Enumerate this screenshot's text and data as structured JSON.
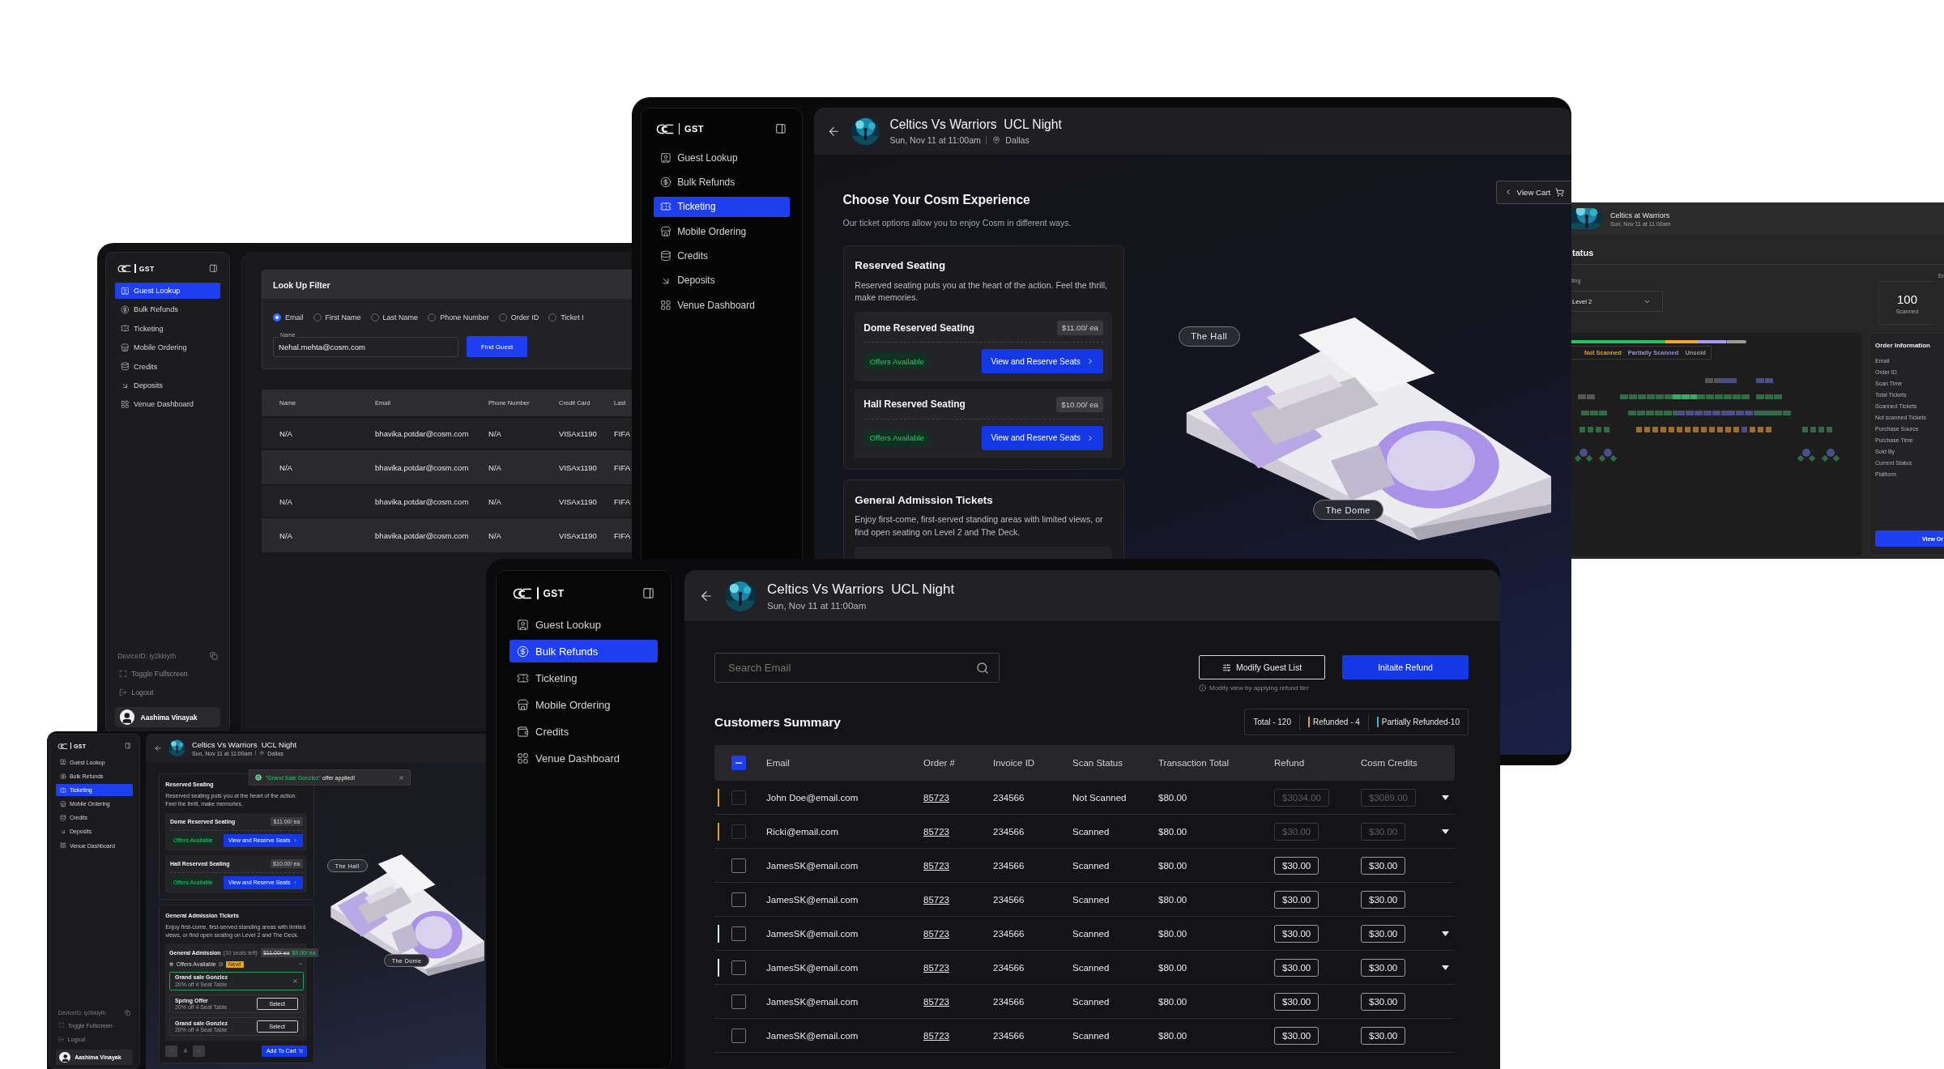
{
  "guest_lookup_screen": {
    "sidebar": {
      "brand": "GST",
      "items": [
        {
          "label": "Guest Lookup",
          "selected": true
        },
        {
          "label": "Bulk Refunds",
          "selected": false
        },
        {
          "label": "Ticketing",
          "selected": false
        },
        {
          "label": "Mobile Ordering",
          "selected": false
        },
        {
          "label": "Credits",
          "selected": false
        },
        {
          "label": "Deposits",
          "selected": false
        },
        {
          "label": "Venue Dashboard",
          "selected": false
        }
      ],
      "footer": {
        "device_id": "DeviceID: iy2kkiyth",
        "links": [
          "Toggle Fullscreen",
          "Logout"
        ],
        "user": "Aashima Vinayak"
      }
    },
    "filter": {
      "title": "Look Up Filter",
      "options": [
        {
          "label": "Email",
          "selected": true
        },
        {
          "label": "First Name",
          "selected": false
        },
        {
          "label": "Last Name",
          "selected": false
        },
        {
          "label": "Phone Number",
          "selected": false
        },
        {
          "label": "Order ID",
          "selected": false
        },
        {
          "label": "Ticket I",
          "selected": false
        }
      ],
      "field": {
        "label": "Name",
        "value": "Nehal.mehta@cosm.com"
      },
      "button": "Find Guest"
    },
    "table": {
      "columns": [
        "Name",
        "Email",
        "Phone Number",
        "Credit Card",
        "Last"
      ],
      "rows": [
        [
          "N/A",
          "bhavika.potdar@cosm.com",
          "N/A",
          "VISAx1190",
          "FIFA"
        ],
        [
          "N/A",
          "bhavika.potdar@cosm.com",
          "N/A",
          "VISAx1190",
          "FIFA"
        ],
        [
          "N/A",
          "bhavika.potdar@cosm.com",
          "N/A",
          "VISAx1190",
          "FIFA"
        ],
        [
          "N/A",
          "bhavika.potdar@cosm.com",
          "N/A",
          "VISAx1190",
          "FIFA"
        ]
      ]
    }
  },
  "ticketing_screen": {
    "sidebar": {
      "brand": "GST",
      "items": [
        {
          "label": "Guest Lookup",
          "selected": false
        },
        {
          "label": "Bulk Refunds",
          "selected": false
        },
        {
          "label": "Ticketing",
          "selected": true
        },
        {
          "label": "Mobile Ordering",
          "selected": false
        },
        {
          "label": "Credits",
          "selected": false
        },
        {
          "label": "Deposits",
          "selected": false
        },
        {
          "label": "Venue Dashboard",
          "selected": false
        }
      ]
    },
    "event": {
      "title": "Celtics Vs Warriors  UCL Night",
      "date": "Sun, Nov 11 at 11:00am",
      "location": "Dallas"
    },
    "heading": "Choose Your Cosm Experience",
    "subtitle": "Our ticket options allow you to enjoy Cosm in different ways.",
    "view_cart": "View Cart",
    "sections": [
      {
        "title": "Reserved Seating",
        "description": "Reserved seating puts you at the heart of the action. Feel the thrill, make memories.",
        "options": [
          {
            "name": "Dome Reserved Seating",
            "price": "$11.00/ ea",
            "offers": "Offers Available",
            "action": "View and Reserve Seats"
          },
          {
            "name": "Hall Reserved Seating",
            "price": "$10.00/ ea",
            "offers": "Offers Available",
            "action": "View and Reserve Seats"
          }
        ]
      },
      {
        "title": "General Admission Tickets",
        "description": "Enjoy first-come, first-served standing areas with limited views, or find open seating on Level 2 and The Deck."
      }
    ],
    "venue_labels": [
      "The Hall",
      "The Dome"
    ]
  },
  "status_screen": {
    "event": {
      "title": "Celtics at Warriors",
      "date": "Sun, Nov 11 at 11:00am"
    },
    "heading": "tatus",
    "filter_label": "ting",
    "select": "Level 2",
    "stat": {
      "value": "100",
      "label": "Scanned"
    },
    "next_stat_label": "Er",
    "legend": [
      {
        "label": "Not Scanned",
        "color": "#d9a03c"
      },
      {
        "label": "Partially Scanned",
        "color": "#8e8ee6"
      },
      {
        "label": "Unsold",
        "color": "#9a9a9a"
      }
    ],
    "order_info": {
      "title": "Order Information",
      "fields": [
        "Email",
        "Order ID",
        "Scan Time",
        "Total Tickets",
        "Scanned Tickets",
        "Not scanned Tickets",
        "Purchase Source",
        "Purchase Time",
        "Sold By",
        "Current Status",
        "Platform"
      ],
      "button": "View Or"
    }
  },
  "ticketing_screen_small": {
    "sidebar": {
      "brand": "GST",
      "items": [
        {
          "label": "Guest Lookup",
          "selected": false
        },
        {
          "label": "Bulk Refunds",
          "selected": false
        },
        {
          "label": "Ticketing",
          "selected": true
        },
        {
          "label": "Mobile Ordering",
          "selected": false
        },
        {
          "label": "Credits",
          "selected": false
        },
        {
          "label": "Deposits",
          "selected": false
        },
        {
          "label": "Venue Dashboard",
          "selected": false
        }
      ],
      "footer": {
        "device_id": "DeviceID: iy2kkiyth",
        "links": [
          "Toggle Fullscreen",
          "Logout"
        ],
        "user": "Aashima Vinayak"
      }
    },
    "event": {
      "title": "Celtics Vs Warriors  UCL Night",
      "date": "Sun, Nov 11 at 11:00am",
      "location": "Dallas"
    },
    "toast": {
      "offer": "\"Grand Sale Gonzlez\"",
      "message": "offer applied!"
    },
    "sections": [
      {
        "title": "Reserved Seating",
        "description": "Reserved seating puts you at the heart of the action. Feel the thrill, make memories.",
        "options": [
          {
            "name": "Dome Reserved Seating",
            "price": "$11.00/ ea",
            "offers": "Offers Available",
            "action": "View and Reserve Seats"
          },
          {
            "name": "Hall Reserved Seating",
            "price": "$10.00/ ea",
            "offers": "Offers Available",
            "action": "View and Reserve Seats"
          }
        ]
      },
      {
        "title": "General Admission Tickets",
        "description": "Enjoy first-come, first-served standing areas with limited views, or find open seating on Level 2 and The Deck.",
        "admission": {
          "name": "General Admission",
          "note": "(10 seats left)",
          "old_price": "$11.00/ ea",
          "price": "$9.00/ ea",
          "offers_label": "Offers Available",
          "badge": "New!",
          "expanded": true,
          "offers": [
            {
              "name": "Grand sale Gonzlez",
              "detail": "20% off 4 Seat Table",
              "selected": true
            },
            {
              "name": "Spring Offer",
              "detail": "20% off 4 Seat Table",
              "selected": false,
              "action": "Select"
            },
            {
              "name": "Grand sale Gonzlez",
              "detail": "20% off 4 Seat Table",
              "selected": false,
              "action": "Select"
            }
          ],
          "quantity": "4",
          "add_to_cart": "Add To Cart"
        }
      }
    ],
    "venue_labels": [
      "The Hall",
      "The Dome"
    ]
  },
  "bulk_refunds_screen": {
    "sidebar": {
      "brand": "GST",
      "items": [
        {
          "label": "Guest Lookup",
          "selected": false
        },
        {
          "label": "Bulk Refunds",
          "selected": true
        },
        {
          "label": "Ticketing",
          "selected": false
        },
        {
          "label": "Mobile Ordering",
          "selected": false
        },
        {
          "label": "Credits",
          "selected": false
        },
        {
          "label": "Venue Dashboard",
          "selected": false
        }
      ]
    },
    "event": {
      "title": "Celtics Vs Warriors  UCL Night",
      "date": "Sun, Nov 11 at 11:00am"
    },
    "search": {
      "placeholder": "Search Email"
    },
    "modify_button": "Modify Guest List",
    "hint": "Modify view by applying refund tier",
    "refund_button": "Initaite Refund",
    "summary_title": "Customers Summary",
    "stats": [
      {
        "label": "Total - 120"
      },
      {
        "label": "Refunded - 4",
        "color": "#e0a030"
      },
      {
        "label": "Partially Refunded-10",
        "color": "#2bb5dd"
      }
    ],
    "table": {
      "all_checked": true,
      "columns": [
        "Email",
        "Order #",
        "Invoice ID",
        "Scan Status",
        "Transaction Total",
        "Refund",
        "Cosm Credits"
      ],
      "rows": [
        {
          "email": "John Doe@email.com",
          "order": "85723",
          "invoice": "234566",
          "scan_status": "Not Scanned",
          "total": "$80.00",
          "refund": "$3034.00",
          "credits": "$3089.00",
          "checked": false,
          "disabled": true,
          "expandable": true,
          "color": "#e0a030"
        },
        {
          "email": "Ricki@email.com",
          "order": "85723",
          "invoice": "234566",
          "scan_status": "Scanned",
          "total": "$80.00",
          "refund": "$30.00",
          "credits": "$30.00",
          "checked": false,
          "disabled": true,
          "expandable": true,
          "color": "#e0a030"
        },
        {
          "email": "JamesSK@email.com",
          "order": "85723",
          "invoice": "234566",
          "scan_status": "Scanned",
          "total": "$80.00",
          "refund": "$30.00",
          "credits": "$30.00",
          "checked": false,
          "disabled": false,
          "expandable": false
        },
        {
          "email": "JamesSK@email.com",
          "order": "85723",
          "invoice": "234566",
          "scan_status": "Scanned",
          "total": "$80.00",
          "refund": "$30.00",
          "credits": "$30.00",
          "checked": false,
          "disabled": false,
          "expandable": false
        },
        {
          "email": "JamesSK@email.com",
          "order": "85723",
          "invoice": "234566",
          "scan_status": "Scanned",
          "total": "$80.00",
          "refund": "$30.00",
          "credits": "$30.00",
          "checked": false,
          "disabled": false,
          "expandable": true,
          "color": "#d8eef5"
        },
        {
          "email": "JamesSK@email.com",
          "order": "85723",
          "invoice": "234566",
          "scan_status": "Scanned",
          "total": "$80.00",
          "refund": "$30.00",
          "credits": "$30.00",
          "checked": false,
          "disabled": false,
          "expandable": true,
          "color": "#d8eef5"
        },
        {
          "email": "JamesSK@email.com",
          "order": "85723",
          "invoice": "234566",
          "scan_status": "Scanned",
          "total": "$80.00",
          "refund": "$30.00",
          "credits": "$30.00",
          "checked": false,
          "disabled": false,
          "expandable": false
        },
        {
          "email": "JamesSK@email.com",
          "order": "85723",
          "invoice": "234566",
          "scan_status": "Scanned",
          "total": "$80.00",
          "refund": "$30.00",
          "credits": "$30.00",
          "checked": false,
          "disabled": false,
          "expandable": false
        }
      ]
    }
  }
}
